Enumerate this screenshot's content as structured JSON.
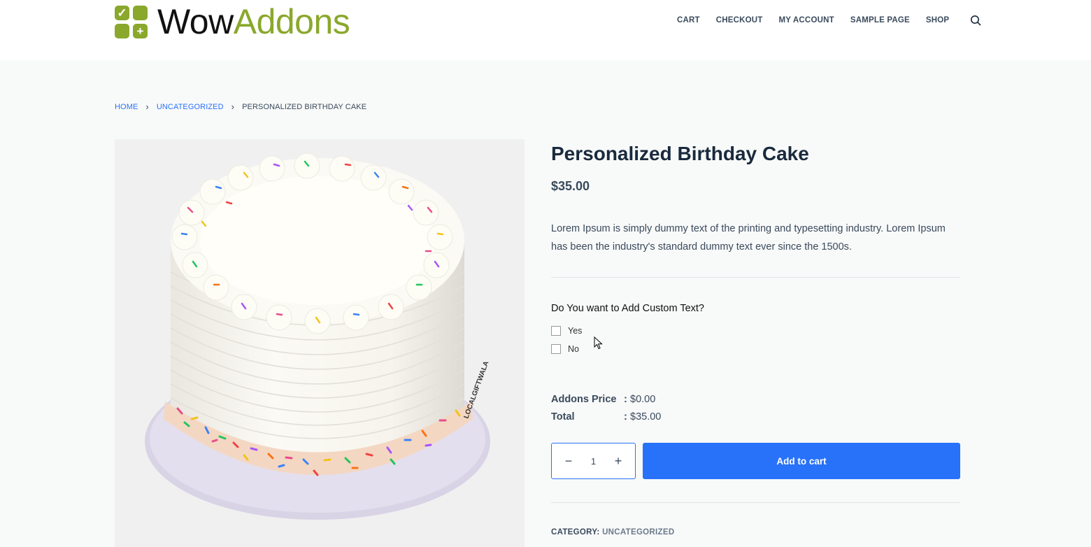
{
  "brand": {
    "part1": "Wow",
    "part2": "Addons",
    "accent": "#8aa82c"
  },
  "nav": {
    "items": [
      "CART",
      "CHECKOUT",
      "MY ACCOUNT",
      "SAMPLE PAGE",
      "SHOP"
    ],
    "search_icon": "search-icon"
  },
  "breadcrumb": {
    "home": "HOME",
    "category": "UNCATEGORIZED",
    "current": "PERSONALIZED BIRTHDAY CAKE",
    "separator": "›"
  },
  "product": {
    "title": "Personalized Birthday Cake",
    "price": "$35.00",
    "description": "Lorem Ipsum is simply dummy text of the printing and typesetting industry. Lorem Ipsum has been the industry's standard dummy text ever since the 1500s.",
    "image_watermark": "LOCALGIFTWALA"
  },
  "addon": {
    "question": "Do You want to Add Custom Text?",
    "options": [
      {
        "label": "Yes",
        "checked": false
      },
      {
        "label": "No",
        "checked": false
      }
    ]
  },
  "totals": {
    "addons_label": "Addons Price",
    "addons_value": "$0.00",
    "total_label": "Total",
    "total_value": "$35.00",
    "colon": ":"
  },
  "cart": {
    "quantity": "1",
    "minus": "−",
    "plus": "+",
    "add_label": "Add to cart",
    "button_color": "#2872fa"
  },
  "meta": {
    "category_label": "CATEGORY:",
    "category_value": "UNCATEGORIZED"
  }
}
